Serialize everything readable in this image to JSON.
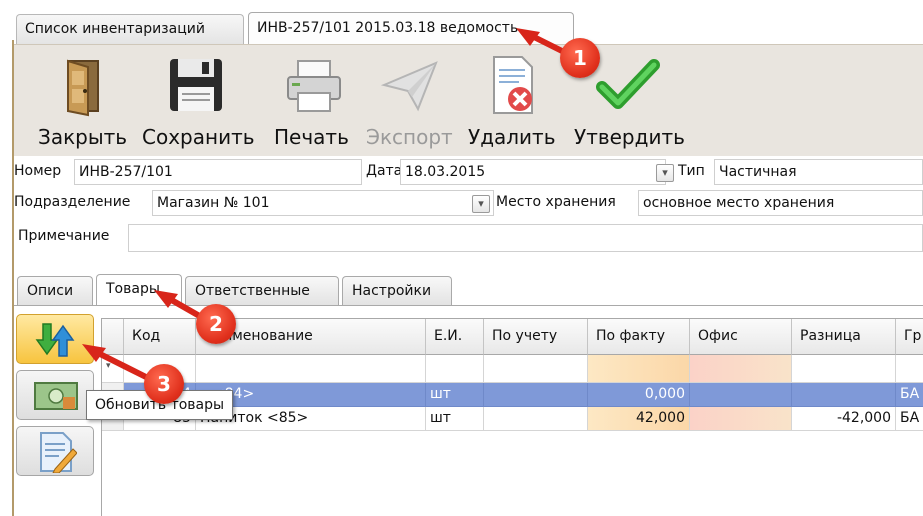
{
  "top_tabs": [
    {
      "label": "Список инвентаризаций"
    },
    {
      "label": "ИНВ-257/101 2015.03.18 ведомость"
    }
  ],
  "toolbar": {
    "close_label": "Закрыть",
    "save_label": "Сохранить",
    "print_label": "Печать",
    "export_label": "Экспорт",
    "delete_label": "Удалить",
    "approve_label": "Утвердить"
  },
  "form": {
    "number_label": "Номер",
    "number_value": "ИНВ-257/101",
    "date_label": "Дата",
    "date_value": "18.03.2015",
    "type_label": "Тип",
    "type_value": "Частичная",
    "division_label": "Подразделение",
    "division_value": "Магазин № 101",
    "storage_label": "Место хранения",
    "storage_value": "основное место хранения",
    "note_label": "Примечание",
    "note_value": ""
  },
  "inner_tabs": [
    {
      "label": "Описи"
    },
    {
      "label": "Товары"
    },
    {
      "label": "Ответственные"
    },
    {
      "label": "Настройки"
    }
  ],
  "tooltip": "Обновить товары",
  "grid": {
    "columns": [
      "Код",
      "Наименование",
      "Е.И.",
      "По учету",
      "По факту",
      "Офис",
      "Разница",
      "Гр"
    ],
    "rows": [
      {
        "code": "84",
        "name": "к  <84>",
        "unit": "шт",
        "po_uchetu": "",
        "po_faktu": "0,000",
        "office": "",
        "diff": "",
        "group": "БА"
      },
      {
        "code": "85",
        "name": "Напиток  <85>",
        "unit": "шт",
        "po_uchetu": "",
        "po_faktu": "42,000",
        "office": "",
        "diff": "-42,000",
        "group": "БА"
      }
    ]
  },
  "callouts": [
    "1",
    "2",
    "3"
  ],
  "colors": {
    "toolbar_bg": "#e9e5df",
    "selected_row": "#7f99d8",
    "active_side_button": "#f7c43f",
    "callout_red": "#e0301c"
  }
}
